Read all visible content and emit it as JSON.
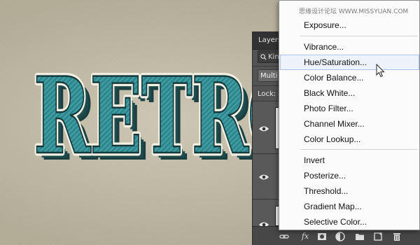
{
  "canvas": {
    "retro_text": "RETRO",
    "colors": {
      "background": "#c3bba4",
      "letter_fill": "#3a9aa0",
      "letter_outline": "#f4f0e4",
      "letter_extrude": "#1f4a4c"
    }
  },
  "layers_panel": {
    "title": "Layers",
    "search_text": "Kin",
    "blend_mode": "Multi",
    "lock_label": "Lock:",
    "footer_icons": [
      "link-icon",
      "fx-icon",
      "mask-icon",
      "adjustment-icon",
      "folder-icon",
      "new-layer-icon",
      "trash-icon"
    ],
    "fx_label": "fx"
  },
  "adjustment_menu": {
    "watermark": "思缘设计论坛 WWW.MISSYUAN.COM",
    "items": [
      "Exposure...",
      "Vibrance...",
      "Hue/Saturation...",
      "Color Balance...",
      "Black  White...",
      "Photo Filter...",
      "Channel Mixer...",
      "Color Lookup...",
      "Invert",
      "Posterize...",
      "Threshold...",
      "Gradient Map...",
      "Selective Color..."
    ],
    "active_item": "Hue/Saturation..."
  }
}
